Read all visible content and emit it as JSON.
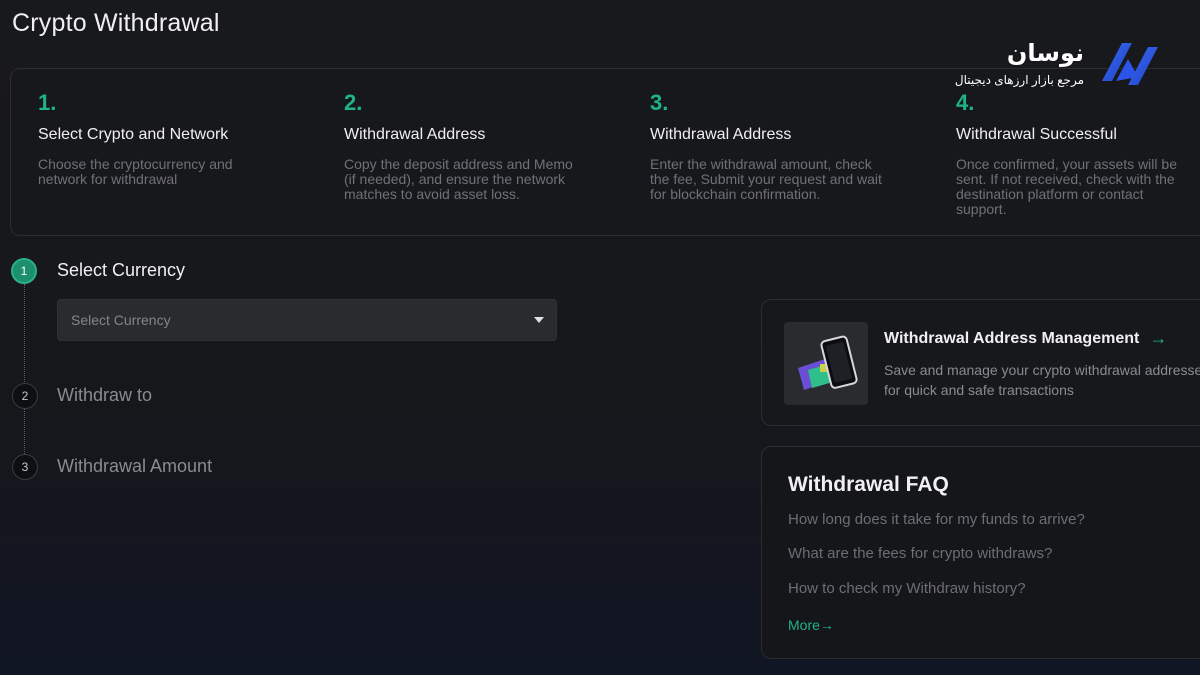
{
  "page": {
    "title": "Crypto Withdrawal"
  },
  "steps": [
    {
      "number": "1.",
      "title": "Select Crypto and Network",
      "desc": [
        "Choose the cryptocurrency and",
        "network for withdrawal"
      ]
    },
    {
      "number": "2.",
      "title": "Withdrawal Address",
      "desc": [
        "Copy the deposit address and Memo",
        "(if needed), and ensure the network",
        "matches to avoid asset loss."
      ]
    },
    {
      "number": "3.",
      "title": "Withdrawal Address",
      "desc": [
        "Enter the withdrawal amount, check",
        "the fee, Submit your request and wait",
        "for blockchain confirmation."
      ]
    },
    {
      "number": "4.",
      "title": "Withdrawal Successful",
      "desc": [
        "Once confirmed, your assets will be",
        "sent. If not received, check with the",
        "destination platform or contact",
        "support."
      ]
    }
  ],
  "brand": {
    "name": "نوسان",
    "subtitle": "مرجع بازار ارزهای دیجیتال"
  },
  "stepper": [
    {
      "number": "1",
      "label": "Select Currency",
      "state": "active"
    },
    {
      "number": "2",
      "label": "Withdraw to",
      "state": "idle"
    },
    {
      "number": "3",
      "label": "Withdrawal Amount",
      "state": "idle"
    }
  ],
  "currency_select": {
    "placeholder": "Select Currency"
  },
  "address_card": {
    "title": "Withdrawal Address Management",
    "desc": [
      "Save and manage your crypto withdrawal addresses",
      "for quick and safe transactions"
    ]
  },
  "faq": {
    "title": "Withdrawal FAQ",
    "questions": [
      "How long does it take for my funds to arrive?",
      "What are the fees for crypto withdraws?",
      "How to check my Withdraw history?"
    ],
    "more": "More"
  },
  "colors": {
    "accent": "#1fb38a",
    "background": "#17181b",
    "panel_border": "#2c2d31"
  }
}
